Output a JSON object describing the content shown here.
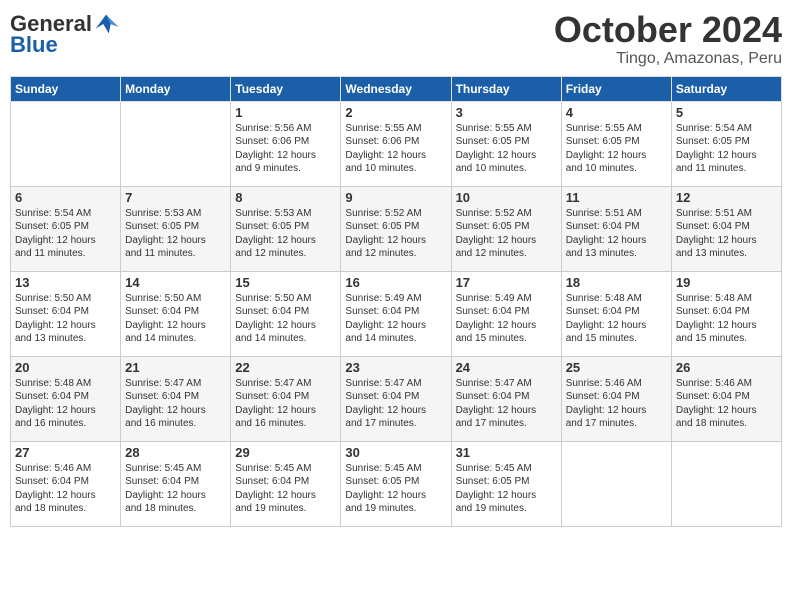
{
  "header": {
    "logo_general": "General",
    "logo_blue": "Blue",
    "month": "October 2024",
    "location": "Tingo, Amazonas, Peru"
  },
  "days_of_week": [
    "Sunday",
    "Monday",
    "Tuesday",
    "Wednesday",
    "Thursday",
    "Friday",
    "Saturday"
  ],
  "weeks": [
    [
      {
        "day": "",
        "info": ""
      },
      {
        "day": "",
        "info": ""
      },
      {
        "day": "1",
        "info": "Sunrise: 5:56 AM\nSunset: 6:06 PM\nDaylight: 12 hours\nand 9 minutes."
      },
      {
        "day": "2",
        "info": "Sunrise: 5:55 AM\nSunset: 6:06 PM\nDaylight: 12 hours\nand 10 minutes."
      },
      {
        "day": "3",
        "info": "Sunrise: 5:55 AM\nSunset: 6:05 PM\nDaylight: 12 hours\nand 10 minutes."
      },
      {
        "day": "4",
        "info": "Sunrise: 5:55 AM\nSunset: 6:05 PM\nDaylight: 12 hours\nand 10 minutes."
      },
      {
        "day": "5",
        "info": "Sunrise: 5:54 AM\nSunset: 6:05 PM\nDaylight: 12 hours\nand 11 minutes."
      }
    ],
    [
      {
        "day": "6",
        "info": "Sunrise: 5:54 AM\nSunset: 6:05 PM\nDaylight: 12 hours\nand 11 minutes."
      },
      {
        "day": "7",
        "info": "Sunrise: 5:53 AM\nSunset: 6:05 PM\nDaylight: 12 hours\nand 11 minutes."
      },
      {
        "day": "8",
        "info": "Sunrise: 5:53 AM\nSunset: 6:05 PM\nDaylight: 12 hours\nand 12 minutes."
      },
      {
        "day": "9",
        "info": "Sunrise: 5:52 AM\nSunset: 6:05 PM\nDaylight: 12 hours\nand 12 minutes."
      },
      {
        "day": "10",
        "info": "Sunrise: 5:52 AM\nSunset: 6:05 PM\nDaylight: 12 hours\nand 12 minutes."
      },
      {
        "day": "11",
        "info": "Sunrise: 5:51 AM\nSunset: 6:04 PM\nDaylight: 12 hours\nand 13 minutes."
      },
      {
        "day": "12",
        "info": "Sunrise: 5:51 AM\nSunset: 6:04 PM\nDaylight: 12 hours\nand 13 minutes."
      }
    ],
    [
      {
        "day": "13",
        "info": "Sunrise: 5:50 AM\nSunset: 6:04 PM\nDaylight: 12 hours\nand 13 minutes."
      },
      {
        "day": "14",
        "info": "Sunrise: 5:50 AM\nSunset: 6:04 PM\nDaylight: 12 hours\nand 14 minutes."
      },
      {
        "day": "15",
        "info": "Sunrise: 5:50 AM\nSunset: 6:04 PM\nDaylight: 12 hours\nand 14 minutes."
      },
      {
        "day": "16",
        "info": "Sunrise: 5:49 AM\nSunset: 6:04 PM\nDaylight: 12 hours\nand 14 minutes."
      },
      {
        "day": "17",
        "info": "Sunrise: 5:49 AM\nSunset: 6:04 PM\nDaylight: 12 hours\nand 15 minutes."
      },
      {
        "day": "18",
        "info": "Sunrise: 5:48 AM\nSunset: 6:04 PM\nDaylight: 12 hours\nand 15 minutes."
      },
      {
        "day": "19",
        "info": "Sunrise: 5:48 AM\nSunset: 6:04 PM\nDaylight: 12 hours\nand 15 minutes."
      }
    ],
    [
      {
        "day": "20",
        "info": "Sunrise: 5:48 AM\nSunset: 6:04 PM\nDaylight: 12 hours\nand 16 minutes."
      },
      {
        "day": "21",
        "info": "Sunrise: 5:47 AM\nSunset: 6:04 PM\nDaylight: 12 hours\nand 16 minutes."
      },
      {
        "day": "22",
        "info": "Sunrise: 5:47 AM\nSunset: 6:04 PM\nDaylight: 12 hours\nand 16 minutes."
      },
      {
        "day": "23",
        "info": "Sunrise: 5:47 AM\nSunset: 6:04 PM\nDaylight: 12 hours\nand 17 minutes."
      },
      {
        "day": "24",
        "info": "Sunrise: 5:47 AM\nSunset: 6:04 PM\nDaylight: 12 hours\nand 17 minutes."
      },
      {
        "day": "25",
        "info": "Sunrise: 5:46 AM\nSunset: 6:04 PM\nDaylight: 12 hours\nand 17 minutes."
      },
      {
        "day": "26",
        "info": "Sunrise: 5:46 AM\nSunset: 6:04 PM\nDaylight: 12 hours\nand 18 minutes."
      }
    ],
    [
      {
        "day": "27",
        "info": "Sunrise: 5:46 AM\nSunset: 6:04 PM\nDaylight: 12 hours\nand 18 minutes."
      },
      {
        "day": "28",
        "info": "Sunrise: 5:45 AM\nSunset: 6:04 PM\nDaylight: 12 hours\nand 18 minutes."
      },
      {
        "day": "29",
        "info": "Sunrise: 5:45 AM\nSunset: 6:04 PM\nDaylight: 12 hours\nand 19 minutes."
      },
      {
        "day": "30",
        "info": "Sunrise: 5:45 AM\nSunset: 6:05 PM\nDaylight: 12 hours\nand 19 minutes."
      },
      {
        "day": "31",
        "info": "Sunrise: 5:45 AM\nSunset: 6:05 PM\nDaylight: 12 hours\nand 19 minutes."
      },
      {
        "day": "",
        "info": ""
      },
      {
        "day": "",
        "info": ""
      }
    ]
  ]
}
